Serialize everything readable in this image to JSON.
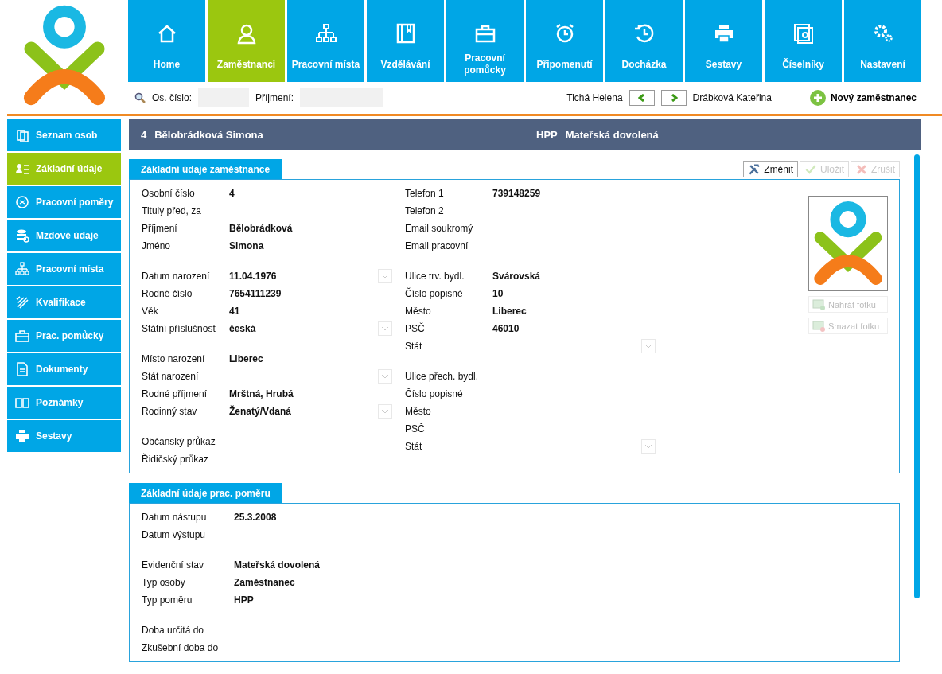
{
  "nav": [
    {
      "label": "Home",
      "selected": false
    },
    {
      "label": "Zaměstnanci",
      "selected": true
    },
    {
      "label": "Pracovní místa",
      "selected": false
    },
    {
      "label": "Vzdělávání",
      "selected": false
    },
    {
      "label": "Pracovní pomůcky",
      "selected": false
    },
    {
      "label": "Připomenutí",
      "selected": false
    },
    {
      "label": "Docházka",
      "selected": false
    },
    {
      "label": "Sestavy",
      "selected": false
    },
    {
      "label": "Číselníky",
      "selected": false
    },
    {
      "label": "Nastavení",
      "selected": false
    }
  ],
  "search": {
    "fields": [
      {
        "label": "Os. číslo:"
      },
      {
        "label": "Příjmení:"
      }
    ]
  },
  "navigator": {
    "previous": "Tichá Helena",
    "next": "Drábková Kateřina"
  },
  "new_button": "Nový zaměstnanec",
  "sidebar": {
    "items": [
      {
        "label": "Seznam osob",
        "selected": false
      },
      {
        "label": "Základní údaje",
        "selected": true
      },
      {
        "label": "Pracovní poměry",
        "selected": false
      },
      {
        "label": "Mzdové údaje",
        "selected": false
      },
      {
        "label": "Pracovní místa",
        "selected": false
      },
      {
        "label": "Kvalifikace",
        "selected": false
      },
      {
        "label": "Prac. pomůcky",
        "selected": false
      },
      {
        "label": "Dokumenty",
        "selected": false
      },
      {
        "label": "Poznámky",
        "selected": false
      },
      {
        "label": "Sestavy",
        "selected": false
      }
    ]
  },
  "header": {
    "number": "4",
    "name": "Bělobrádková Simona",
    "type": "HPP",
    "status": "Mateřská dovolená"
  },
  "employee_section": {
    "title": "Základní údaje zaměstnance",
    "buttons": [
      {
        "label": "Změnit",
        "disabled": false
      },
      {
        "label": "Uložit",
        "disabled": true
      },
      {
        "label": "Zrušit",
        "disabled": true
      }
    ],
    "columns": [
      [
        [
          {
            "label": "Osobní číslo",
            "value": "4",
            "dropdown": false
          },
          {
            "label": "Tituly před, za",
            "dropdown": false
          },
          {
            "label": "Příjmení",
            "value": "Bělobrádková",
            "dropdown": false
          },
          {
            "label": "Jméno",
            "value": "Simona",
            "dropdown": false
          }
        ],
        [
          {
            "label": "Datum narození",
            "value": "11.04.1976",
            "dropdown": true
          },
          {
            "label": "Rodné číslo",
            "value": "7654111239",
            "dropdown": false
          },
          {
            "label": "Věk",
            "value": "41",
            "dropdown": false
          },
          {
            "label": "Státní příslušnost",
            "value": "česká",
            "dropdown": true
          }
        ],
        [
          {
            "label": "Místo narození",
            "value": "Liberec",
            "dropdown": false
          },
          {
            "label": "Stát narození",
            "dropdown": true
          },
          {
            "label": "Rodné příjmení",
            "value": "Mrštná, Hrubá",
            "dropdown": false
          },
          {
            "label": "Rodinný stav",
            "value": "Ženatý/Vdaná",
            "dropdown": true
          }
        ],
        [
          {
            "label": "Občanský průkaz",
            "dropdown": false
          },
          {
            "label": "Řidičský průkaz",
            "dropdown": false
          }
        ]
      ],
      [
        [
          {
            "label": "Telefon 1",
            "value": "739148259",
            "dropdown": false
          },
          {
            "label": "Telefon 2",
            "dropdown": false
          },
          {
            "label": "Email soukromý",
            "dropdown": false
          },
          {
            "label": "Email pracovní",
            "dropdown": false
          }
        ],
        [
          {
            "label": "Ulice trv. bydl.",
            "value": "Svárovská",
            "dropdown": false
          },
          {
            "label": "Číslo popisné",
            "value": "10",
            "dropdown": false
          },
          {
            "label": "Město",
            "value": "Liberec",
            "dropdown": false
          },
          {
            "label": "PSČ",
            "value": "46010",
            "dropdown": false
          },
          {
            "label": "Stát",
            "dropdown": true
          }
        ],
        [
          {
            "label": "Ulice přech. bydl.",
            "dropdown": false
          },
          {
            "label": "Číslo popisné",
            "dropdown": false
          },
          {
            "label": "Město",
            "dropdown": false
          },
          {
            "label": "PSČ",
            "dropdown": false
          },
          {
            "label": "Stát",
            "dropdown": true
          }
        ]
      ]
    ],
    "photo_buttons": [
      {
        "label": "Nahrát fotku",
        "disabled": true
      },
      {
        "label": "Smazat fotku",
        "disabled": true
      }
    ]
  },
  "employment_section": {
    "title": "Základní údaje prac. poměru",
    "groups": [
      [
        {
          "label": "Datum nástupu",
          "value": "25.3.2008"
        },
        {
          "label": "Datum výstupu"
        }
      ],
      [
        {
          "label": "Evidenční stav",
          "value": "Mateřská dovolená"
        },
        {
          "label": "Typ osoby",
          "value": "Zaměstnanec"
        },
        {
          "label": "Typ poměru",
          "value": "HPP"
        }
      ],
      [
        {
          "label": "Doba určitá do"
        },
        {
          "label": "Zkušební doba do"
        }
      ]
    ]
  }
}
